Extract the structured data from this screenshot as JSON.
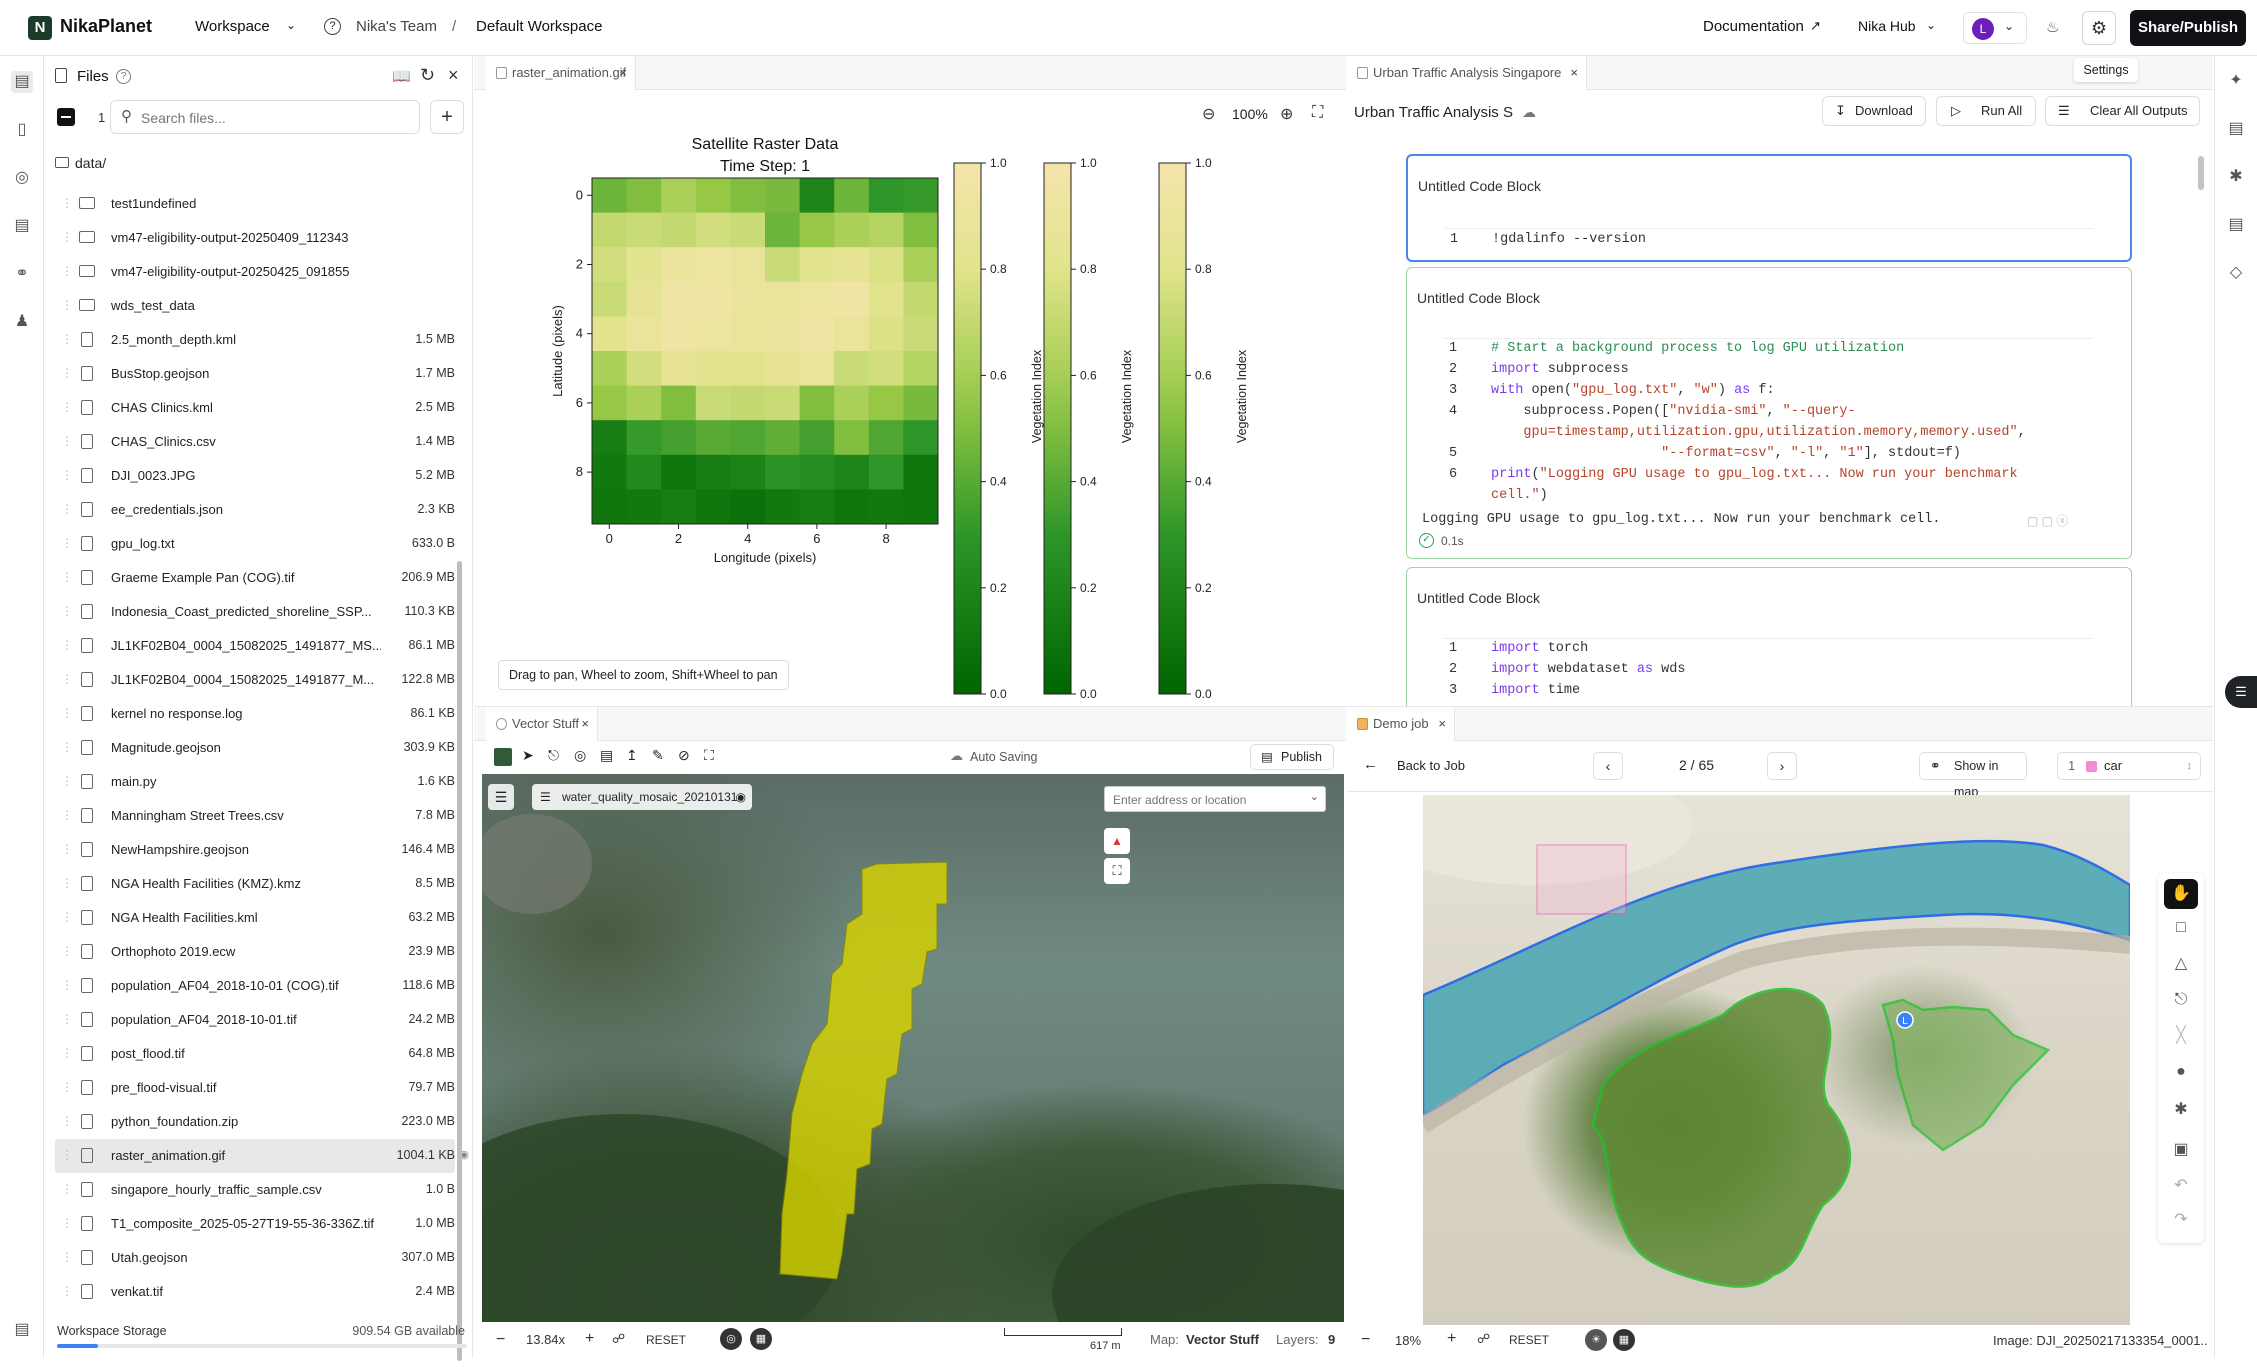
{
  "app": {
    "name": "NikaPlanet",
    "workspace": "Workspace",
    "team": "Nika's Team",
    "separator": "/",
    "workspace_name": "Default Workspace",
    "documentation": "Documentation",
    "hub": "Nika Hub",
    "avatar": "L",
    "share": "Share/Publish",
    "settings_tooltip": "Settings"
  },
  "files": {
    "title": "Files",
    "count": "1",
    "search_placeholder": "Search files...",
    "root": "data/",
    "items": [
      {
        "name": "test1undefined",
        "size": "",
        "type": "folder"
      },
      {
        "name": "vm47-eligibility-output-20250409_112343",
        "size": "",
        "type": "folder"
      },
      {
        "name": "vm47-eligibility-output-20250425_091855",
        "size": "",
        "type": "folder"
      },
      {
        "name": "wds_test_data",
        "size": "",
        "type": "folder"
      },
      {
        "name": "2.5_month_depth.kml",
        "size": "1.5 MB",
        "type": "file"
      },
      {
        "name": "BusStop.geojson",
        "size": "1.7 MB",
        "type": "file"
      },
      {
        "name": "CHAS Clinics.kml",
        "size": "2.5 MB",
        "type": "file"
      },
      {
        "name": "CHAS_Clinics.csv",
        "size": "1.4 MB",
        "type": "file"
      },
      {
        "name": "DJI_0023.JPG",
        "size": "5.2 MB",
        "type": "file"
      },
      {
        "name": "ee_credentials.json",
        "size": "2.3 KB",
        "type": "file"
      },
      {
        "name": "gpu_log.txt",
        "size": "633.0 B",
        "type": "file"
      },
      {
        "name": "Graeme Example Pan (COG).tif",
        "size": "206.9 MB",
        "type": "file"
      },
      {
        "name": "Indonesia_Coast_predicted_shoreline_SSP...",
        "size": "110.3 KB",
        "type": "file"
      },
      {
        "name": "JL1KF02B04_0004_15082025_1491877_MS...",
        "size": "86.1 MB",
        "type": "file"
      },
      {
        "name": "JL1KF02B04_0004_15082025_1491877_M...",
        "size": "122.8 MB",
        "type": "file"
      },
      {
        "name": "kernel no response.log",
        "size": "86.1 KB",
        "type": "file"
      },
      {
        "name": "Magnitude.geojson",
        "size": "303.9 KB",
        "type": "file"
      },
      {
        "name": "main.py",
        "size": "1.6 KB",
        "type": "file"
      },
      {
        "name": "Manningham Street Trees.csv",
        "size": "7.8 MB",
        "type": "file"
      },
      {
        "name": "NewHampshire.geojson",
        "size": "146.4 MB",
        "type": "file"
      },
      {
        "name": "NGA Health Facilities (KMZ).kmz",
        "size": "8.5 MB",
        "type": "file"
      },
      {
        "name": "NGA Health Facilities.kml",
        "size": "63.2 MB",
        "type": "file"
      },
      {
        "name": "Orthophoto 2019.ecw",
        "size": "23.9 MB",
        "type": "file"
      },
      {
        "name": "population_AF04_2018-10-01 (COG).tif",
        "size": "118.6 MB",
        "type": "file"
      },
      {
        "name": "population_AF04_2018-10-01.tif",
        "size": "24.2 MB",
        "type": "file"
      },
      {
        "name": "post_flood.tif",
        "size": "64.8 MB",
        "type": "file"
      },
      {
        "name": "pre_flood-visual.tif",
        "size": "79.7 MB",
        "type": "file"
      },
      {
        "name": "python_foundation.zip",
        "size": "223.0 MB",
        "type": "file"
      },
      {
        "name": "raster_animation.gif",
        "size": "1004.1 KB",
        "type": "file",
        "selected": true
      },
      {
        "name": "singapore_hourly_traffic_sample.csv",
        "size": "1.0 B",
        "type": "file"
      },
      {
        "name": "T1_composite_2025-05-27T19-55-36-336Z.tif",
        "size": "1.0 MB",
        "type": "file"
      },
      {
        "name": "Utah.geojson",
        "size": "307.0 MB",
        "type": "file"
      },
      {
        "name": "venkat.tif",
        "size": "2.4 MB",
        "type": "file"
      }
    ],
    "storage_label": "Workspace Storage",
    "storage_available": "909.54 GB available",
    "storage_used_fraction": 0.1
  },
  "viewer": {
    "tab": "raster_animation.gif",
    "zoom": "100%",
    "hint": "Drag to pan, Wheel to zoom, Shift+Wheel to pan"
  },
  "notebook": {
    "tab": "Urban Traffic Analysis Singapore",
    "title": "Urban Traffic Analysis S",
    "download": "Download",
    "run_all": "Run All",
    "clear": "Clear All Outputs",
    "blocks": [
      {
        "title": "Untitled Code Block"
      },
      {
        "title": "Untitled Code Block",
        "output": "Logging GPU usage to gpu_log.txt... Now run your benchmark cell.",
        "time": "0.1s"
      },
      {
        "title": "Untitled Code Block"
      }
    ]
  },
  "vector": {
    "tab": "Vector Stuff",
    "autosave": "Auto Saving",
    "publish": "Publish",
    "layer": "water_quality_mosaic_20210131",
    "address_placeholder": "Enter address or location",
    "zoom": "13.84x",
    "reset": "RESET",
    "scale": "617 m",
    "map_label": "Map:",
    "map_name": "Vector Stuff",
    "layers_label": "Layers:",
    "layers": "9"
  },
  "demo": {
    "tab": "Demo job",
    "back": "Back to Job",
    "pager": "2 / 65",
    "show_in_map": "Show in map",
    "class_num": "1",
    "class_name": "car",
    "zoom": "18%",
    "reset": "RESET",
    "image": "Image: DJI_20250217133354_0001..."
  },
  "chart_data": {
    "type": "heatmap",
    "title": "Satellite Raster Data",
    "subtitle": "Time Step: 1",
    "xlabel": "Longitude (pixels)",
    "ylabel": "Latitude (pixels)",
    "xticks": [
      "0",
      "2",
      "4",
      "6",
      "8"
    ],
    "yticks": [
      "0",
      "2",
      "4",
      "6",
      "8"
    ],
    "colorbar_label": "Vegetation Index",
    "colorbar_ticks": [
      "1.0",
      "0.8",
      "0.6",
      "0.4",
      "0.2",
      "0.0"
    ],
    "vlim": [
      0,
      1
    ],
    "values": [
      [
        0.45,
        0.5,
        0.62,
        0.55,
        0.5,
        0.48,
        0.2,
        0.45,
        0.3,
        0.32
      ],
      [
        0.7,
        0.72,
        0.7,
        0.75,
        0.72,
        0.45,
        0.55,
        0.62,
        0.65,
        0.5
      ],
      [
        0.75,
        0.82,
        0.9,
        0.92,
        0.88,
        0.72,
        0.8,
        0.85,
        0.78,
        0.62
      ],
      [
        0.72,
        0.85,
        0.95,
        0.95,
        0.9,
        0.88,
        0.92,
        0.95,
        0.8,
        0.7
      ],
      [
        0.8,
        0.88,
        0.95,
        0.92,
        0.88,
        0.9,
        0.95,
        0.88,
        0.78,
        0.72
      ],
      [
        0.62,
        0.75,
        0.85,
        0.82,
        0.8,
        0.85,
        0.88,
        0.72,
        0.75,
        0.65
      ],
      [
        0.55,
        0.62,
        0.5,
        0.72,
        0.7,
        0.72,
        0.5,
        0.62,
        0.55,
        0.48
      ],
      [
        0.15,
        0.32,
        0.35,
        0.4,
        0.38,
        0.42,
        0.35,
        0.5,
        0.38,
        0.3
      ],
      [
        0.12,
        0.22,
        0.1,
        0.15,
        0.18,
        0.28,
        0.25,
        0.2,
        0.3,
        0.1
      ],
      [
        0.1,
        0.12,
        0.15,
        0.1,
        0.08,
        0.12,
        0.15,
        0.1,
        0.12,
        0.1
      ]
    ]
  }
}
